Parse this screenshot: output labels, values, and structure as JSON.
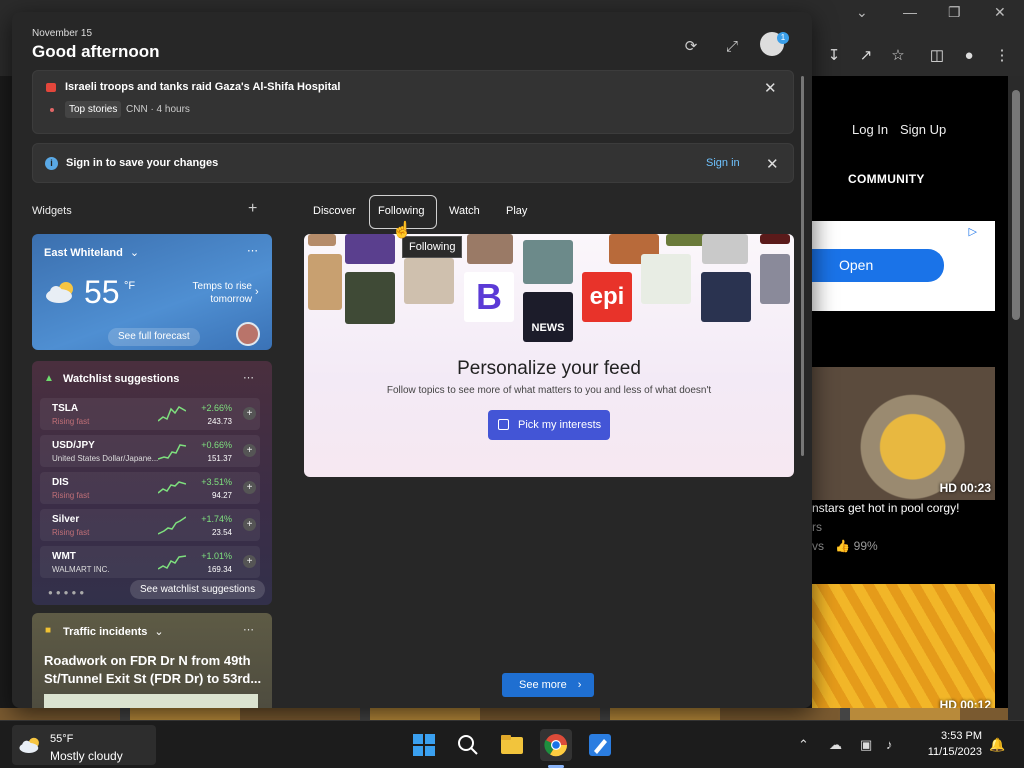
{
  "panel": {
    "date": "November 15",
    "greeting": "Good afternoon",
    "avatar_badge": "1"
  },
  "news": {
    "headline": "Israeli troops and tanks raid Gaza's Al-Shifa Hospital",
    "tag": "Top stories",
    "source": "CNN · 4 hours"
  },
  "signin_bar": {
    "message": "Sign in to save your changes",
    "link": "Sign in"
  },
  "widgets": {
    "label": "Widgets",
    "weather": {
      "location": "East Whiteland",
      "temp": "55",
      "unit": "°F",
      "note": "Temps to rise tomorrow",
      "forecast_button": "See full forecast"
    },
    "watchlist": {
      "title": "Watchlist suggestions",
      "rows": [
        {
          "symbol": "TSLA",
          "sub": "Rising fast",
          "change": "+2.66%",
          "price": "243.73"
        },
        {
          "symbol": "USD/JPY",
          "sub": "United States Dollar/Japane...",
          "change": "+0.66%",
          "price": "151.37"
        },
        {
          "symbol": "DIS",
          "sub": "Rising fast",
          "change": "+3.51%",
          "price": "94.27"
        },
        {
          "symbol": "Silver",
          "sub": "Rising fast",
          "change": "+1.74%",
          "price": "23.54"
        },
        {
          "symbol": "WMT",
          "sub": "WALMART INC.",
          "change": "+1.01%",
          "price": "169.34"
        }
      ],
      "see_button": "See watchlist suggestions"
    },
    "traffic": {
      "title": "Traffic incidents",
      "body": "Roadwork on FDR Dr N from 49th St/Tunnel Exit St (FDR Dr) to 53rd..."
    }
  },
  "feed_tabs": {
    "discover": "Discover",
    "following": "Following",
    "watch": "Watch",
    "play": "Play",
    "tooltip": "Following"
  },
  "feed": {
    "b_logo": "B",
    "news_logo": "NEWS",
    "epi_logo": "epi",
    "title": "Personalize your feed",
    "subtitle": "Follow topics to see more of what matters to you and less of what doesn't",
    "pick_button": "Pick my interests",
    "see_more": "See more"
  },
  "site": {
    "login": "Log In",
    "signup": "Sign Up",
    "community": "COMMUNITY",
    "ad_button": "Open",
    "video1_badge": "HD 00:23",
    "video1_title": "nstars get hot in pool corgy!",
    "video1_line2": "rs",
    "video1_stats": "vs",
    "video1_rating": "99%",
    "video2_badge": "HD 00:12"
  },
  "taskbar": {
    "temp": "55°F",
    "condition": "Mostly cloudy",
    "time": "3:53 PM",
    "date": "11/15/2023"
  },
  "colors": {
    "accent": "#1f6fd1",
    "pick_button": "#4355d6",
    "positive": "#7ee07e",
    "link": "#6fc3ff"
  }
}
